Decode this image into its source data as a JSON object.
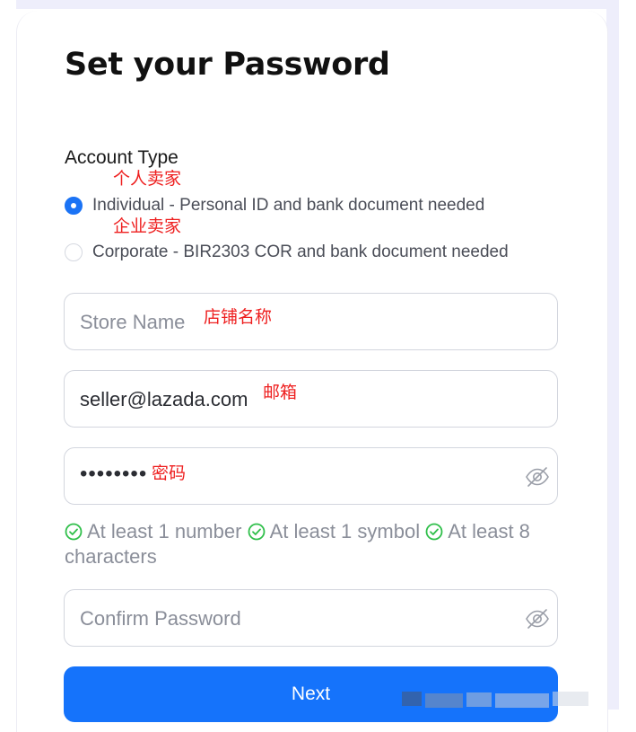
{
  "page": {
    "title": "Set your Password"
  },
  "account_type": {
    "label": "Account Type",
    "options": [
      {
        "label": "Individual - Personal ID and bank document needed",
        "selected": true,
        "annotation": "个人卖家"
      },
      {
        "label": "Corporate - BIR2303 COR and bank document needed",
        "selected": false,
        "annotation": "企业卖家"
      }
    ]
  },
  "fields": {
    "store_name": {
      "placeholder": "Store Name",
      "value": "",
      "annotation": "店铺名称"
    },
    "email": {
      "placeholder": "",
      "value": "seller@lazada.com",
      "annotation": "邮箱"
    },
    "password": {
      "value": "••••••••",
      "annotation": "密码",
      "toggle_icon": "eye-slash-icon"
    },
    "confirm_password": {
      "placeholder": "Confirm Password",
      "value": "",
      "toggle_icon": "eye-slash-icon"
    }
  },
  "requirements": [
    {
      "text": "At least 1 number",
      "met": true,
      "icon": "check-circle-icon"
    },
    {
      "text": "At least 1 symbol",
      "met": true,
      "icon": "check-circle-icon"
    },
    {
      "text": "At least 8 characters",
      "met": true,
      "icon": "check-circle-icon"
    }
  ],
  "actions": {
    "next_label": "Next"
  },
  "colors": {
    "primary": "#1573fb",
    "annotation": "#ee1f1f",
    "success": "#2fbf4a",
    "border": "#d3d6de",
    "placeholder": "#8a8e99"
  }
}
